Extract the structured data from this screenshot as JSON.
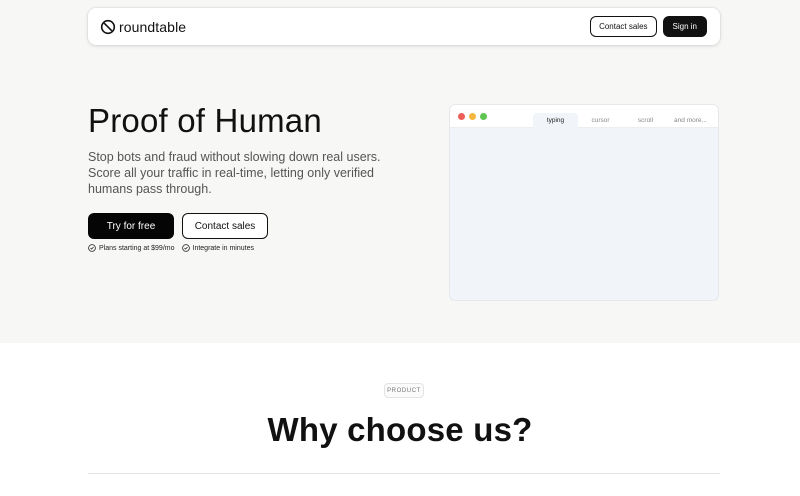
{
  "nav": {
    "brand": "roundtable",
    "contact_label": "Contact sales",
    "signin_label": "Sign in"
  },
  "hero": {
    "title": "Proof of Human",
    "subtitle": "Stop bots and fraud without slowing down real users. Score all your traffic in real-time, letting only verified humans pass through.",
    "primary_cta": "Try for free",
    "secondary_cta": "Contact sales",
    "features": [
      "Plans starting at $99/mo",
      "Integrate in minutes"
    ]
  },
  "demo": {
    "tabs": [
      "typing",
      "cursor",
      "scroll",
      "and more..."
    ],
    "active_tab": "typing",
    "dot_colors": [
      "#ed5f57",
      "#f5b63d",
      "#5fc451"
    ]
  },
  "product_section": {
    "badge": "PRODUCT",
    "title": "Why choose us?"
  }
}
